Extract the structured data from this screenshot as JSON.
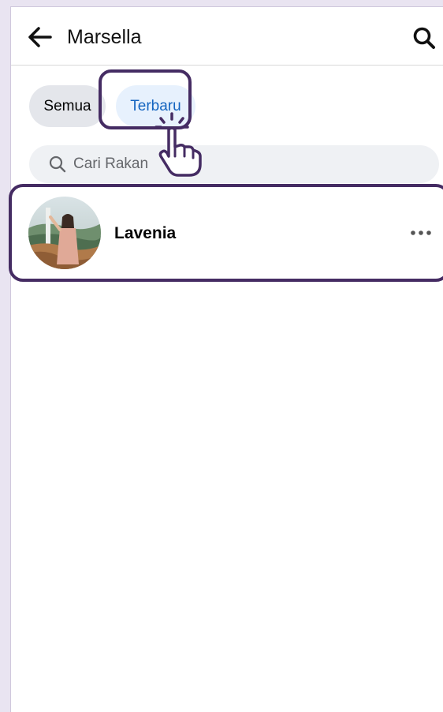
{
  "header": {
    "title": "Marsella",
    "back_icon": "arrow-left-icon",
    "search_icon": "search-icon"
  },
  "filters": {
    "all_label": "Semua",
    "recent_label": "Terbaru",
    "selected": "Terbaru"
  },
  "search": {
    "placeholder": "Cari Rakan",
    "value": ""
  },
  "friends": [
    {
      "name": "Lavenia",
      "more_icon": "more-horizontal-icon"
    }
  ],
  "colors": {
    "accent": "#1565c0",
    "selected_chip_bg": "#e7f1fd",
    "chip_bg": "#e4e6eb",
    "highlight": "#452c63"
  }
}
